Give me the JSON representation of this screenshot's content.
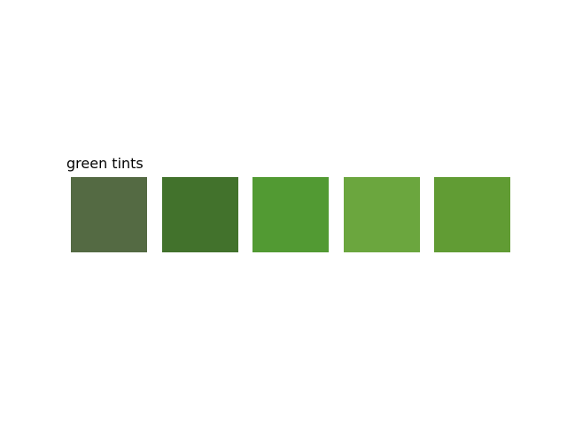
{
  "title": "green tints",
  "swatches": [
    {
      "color": "#546a43"
    },
    {
      "color": "#42722c"
    },
    {
      "color": "#529a33"
    },
    {
      "color": "#6ba63e"
    },
    {
      "color": "#619c34"
    }
  ]
}
